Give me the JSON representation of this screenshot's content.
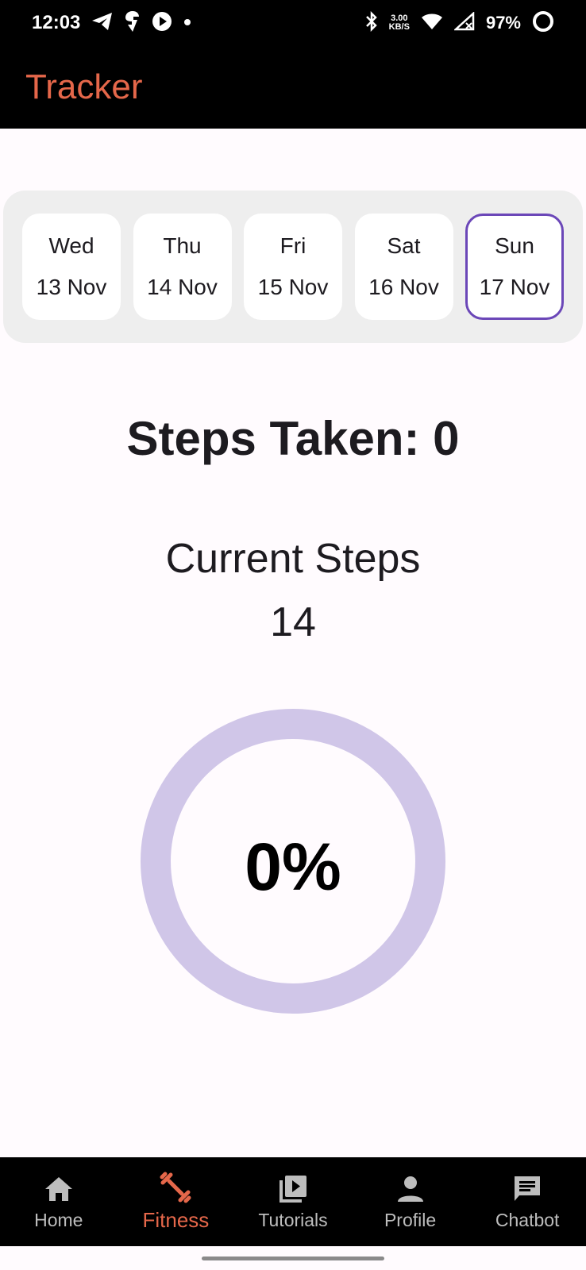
{
  "status_bar": {
    "time": "12:03",
    "speed_value": "3.00",
    "speed_unit": "KB/S",
    "battery": "97%"
  },
  "app_bar": {
    "title": "Tracker"
  },
  "dates": [
    {
      "day": "Wed",
      "date": "13 Nov"
    },
    {
      "day": "Thu",
      "date": "14 Nov"
    },
    {
      "day": "Fri",
      "date": "15 Nov"
    },
    {
      "day": "Sat",
      "date": "16 Nov"
    },
    {
      "day": "Sun",
      "date": "17 Nov"
    }
  ],
  "selected_date_index": 4,
  "steps": {
    "taken_text": "Steps Taken: 0",
    "current_label": "Current Steps",
    "current_value": "14",
    "progress_text": "0%",
    "progress_fraction": 0
  },
  "bottom_nav": {
    "items": [
      {
        "label": "Home",
        "icon": "home-icon"
      },
      {
        "label": "Fitness",
        "icon": "dumbbell-icon"
      },
      {
        "label": "Tutorials",
        "icon": "video-library-icon"
      },
      {
        "label": "Profile",
        "icon": "person-icon"
      },
      {
        "label": "Chatbot",
        "icon": "chat-icon"
      }
    ],
    "active_index": 1
  },
  "colors": {
    "accent": "#e5674a",
    "selected_border": "#6b47b8",
    "ring_track": "#d0c6e8"
  }
}
